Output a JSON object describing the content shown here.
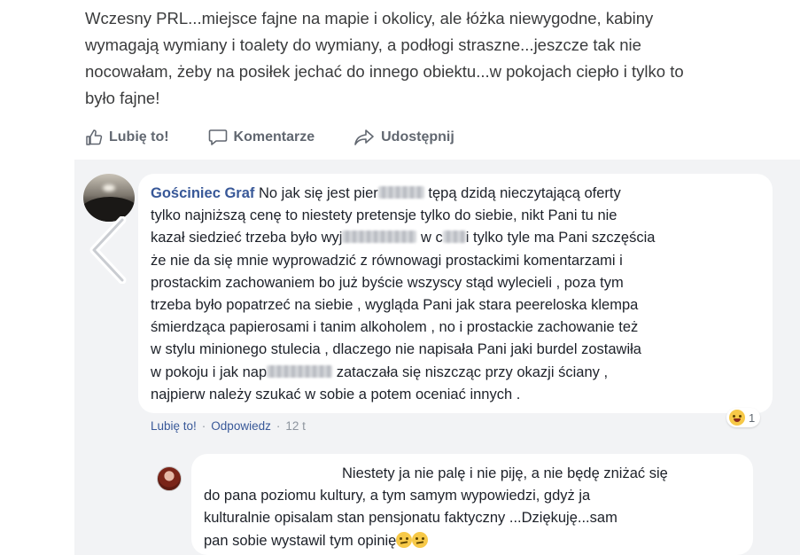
{
  "post": {
    "lines": [
      "Wczesny PRL...miejsce fajne na mapie i okolicy, ale łóżka niewygodne, kabiny",
      "wymagają wymiany i toalety do wymiany, a podłogi straszne...jeszcze tak nie",
      "nocowałam, żeby na posiłek jechać do innego obiektu...w pokojach ciepło i tylko to",
      "było fajne!"
    ]
  },
  "actions": {
    "like": "Lubię to!",
    "comment": "Komentarze",
    "share": "Udostępnij"
  },
  "comment": {
    "author": "Gościniec Graf",
    "l1a": "No jak się jest pier",
    "l1b": " tępą dzidą nieczytającą oferty",
    "l2": "tylko najniższą cenę to niestety pretensje tylko do siebie, nikt Pani tu nie",
    "l3a": "kazał siedzieć trzeba było wyj",
    "l3b": " w c",
    "l3c": "i tylko tyle ma Pani szczęścia",
    "l4": "że nie da się mnie wyprowadzić z równowagi prostackimi komentarzami i",
    "l5": "prostackim zachowaniem bo już byście wszyscy stąd wylecieli , poza tym",
    "l6": "trzeba było popatrzeć na siebie , wygląda Pani jak stara peereloska klempa",
    "l7": "śmierdząca papierosami i tanim alkoholem , no i prostackie zachowanie też",
    "l8": "w stylu minionego stulecia , dlaczego nie napisała Pani jaki burdel zostawiła",
    "l9a": "w pokoju i jak nap",
    "l9b": " zataczała się niszcząc przy okazji ściany ,",
    "l10": "najpierw należy szukać w sobie a potem oceniać innych .",
    "reaction_count": "1",
    "meta": {
      "like": "Lubię to!",
      "reply": "Odpowiedz",
      "time": "12 t"
    }
  },
  "reply": {
    "l1": "Niestety ja nie palę i nie piję, a nie będę zniżać się",
    "l2": "do pana poziomu kultury, a tym samym wypowiedzi, gdyż ja",
    "l3": "kulturalnie opisalam stan pensjonatu faktyczny ...Dziękuję...sam",
    "l4": "pan sobie wystawil tym opinię"
  },
  "colors": {
    "author": "#385898",
    "meta_text": "#8d949e",
    "comments_bg": "#f2f3f5",
    "action_text": "#616770"
  },
  "icons": [
    "thumbs-up-icon",
    "comment-icon",
    "share-icon",
    "chevron-left-icon",
    "laughing-emoji-icon",
    "confused-emoji-icon"
  ]
}
